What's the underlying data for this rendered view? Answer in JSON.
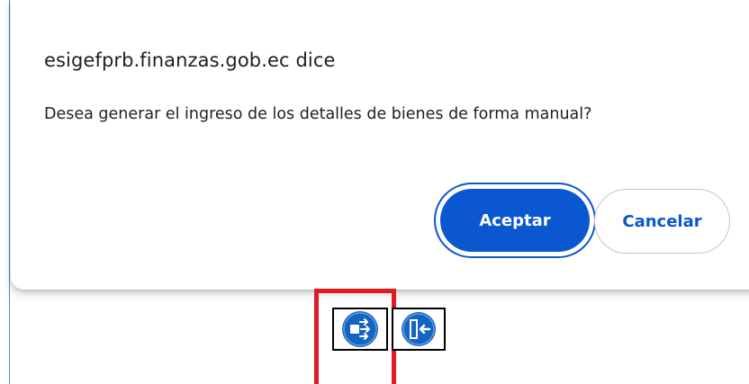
{
  "dialog": {
    "title": "esigefprb.finanzas.gob.ec dice",
    "message": "Desea generar el ingreso de los detalles de bienes de forma manual?",
    "accept_label": "Aceptar",
    "cancel_label": "Cancelar"
  },
  "toolbar": {
    "buttons": [
      {
        "icon": "manual-entry-arrows-icon",
        "highlighted": true,
        "highlight_color": "#e01b24"
      },
      {
        "icon": "exit-door-arrow-icon",
        "highlighted": false
      }
    ]
  },
  "colors": {
    "accent": "#0b57d0",
    "icon_blue": "#1565c0",
    "highlight": "#e01b24"
  }
}
